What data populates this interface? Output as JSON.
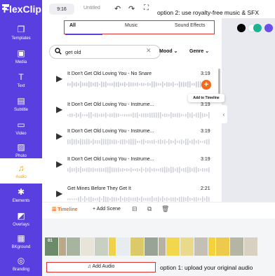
{
  "app": {
    "logo": "FlexClip",
    "ratio": "9:16",
    "title": "Untitled"
  },
  "sidebar": {
    "items": [
      {
        "label": "Templates",
        "icon": "layers-icon"
      },
      {
        "label": "Media",
        "icon": "media-icon"
      },
      {
        "label": "Text",
        "icon": "text-icon"
      },
      {
        "label": "Subtitle",
        "icon": "subtitle-icon"
      },
      {
        "label": "Video",
        "icon": "video-icon"
      },
      {
        "label": "Photo",
        "icon": "photo-icon"
      },
      {
        "label": "Audio",
        "icon": "music-note-icon",
        "active": true
      },
      {
        "label": "Elements",
        "icon": "elements-icon"
      },
      {
        "label": "Overlays",
        "icon": "overlays-icon"
      },
      {
        "label": "BKground",
        "icon": "background-icon"
      },
      {
        "label": "Branding",
        "icon": "branding-icon"
      }
    ]
  },
  "annotations": {
    "option2": "option 2:  use royalty-free music & SFX",
    "option1": "option 1: upload your original audio"
  },
  "tabs": [
    {
      "label": "All",
      "active": true
    },
    {
      "label": "Music"
    },
    {
      "label": "Sound Effects"
    }
  ],
  "search": {
    "value": "get old",
    "mood": "Mood",
    "genre": "Genre"
  },
  "tracks": [
    {
      "name": "It Don't Get Old Loving You - No Snare",
      "duration": "3:19"
    },
    {
      "name": "It Don't Get Old Loving You - Instrume...",
      "duration": "3:19"
    },
    {
      "name": "It Don't Get Old Loving You - Instrume...",
      "duration": "3:19"
    },
    {
      "name": "It Don't Get Old Loving You - Instrume...",
      "duration": "3:19"
    },
    {
      "name": "Get Mines Before They Get It",
      "duration": "2:21"
    }
  ],
  "tooltip": "Add to Timeline",
  "timeline": {
    "label": "Timeline",
    "add_scene": "Add Scene",
    "add_audio": "Add Audio",
    "first_scene": "01"
  },
  "colors": {
    "accent": "#5a3fe0",
    "orange": "#f26b1d",
    "highlight": "#e03030",
    "swatches": [
      "#000000",
      "#ffffff",
      "#1ab394",
      "#6a4ee8"
    ]
  }
}
